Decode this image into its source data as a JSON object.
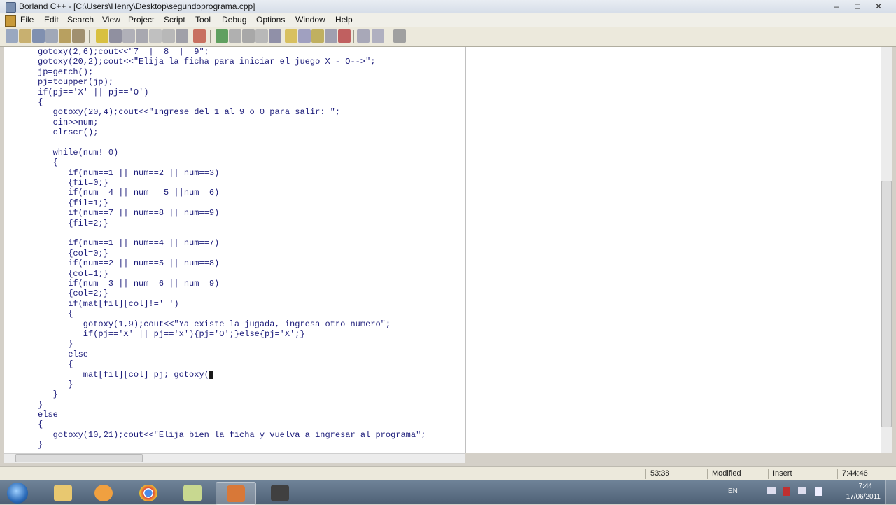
{
  "window": {
    "title": "Borland C++ - [C:\\Users\\Henry\\Desktop\\segundoprograma.cpp]",
    "controls": {
      "minimize": "–",
      "maximize": "□",
      "close": "✕"
    }
  },
  "menu": {
    "items": [
      "File",
      "Edit",
      "Search",
      "View",
      "Project",
      "Script",
      "Tool",
      "Debug",
      "Options",
      "Window",
      "Help"
    ]
  },
  "editor": {
    "file": "segundoprograma.cpp",
    "code_lines": [
      "gotoxy(2,6);cout<<\"7  |  8  |  9\";",
      "gotoxy(20,2);cout<<\"Elija la ficha para iniciar el juego X - O-->\";",
      "jp=getch();",
      "pj=toupper(jp);",
      "if(pj=='X' || pj=='O')",
      "{",
      "   gotoxy(20,4);cout<<\"Ingrese del 1 al 9 o 0 para salir: \";",
      "   cin>>num;",
      "   clrscr();",
      "",
      "   while(num!=0)",
      "   {",
      "      if(num==1 || num==2 || num==3)",
      "      {fil=0;}",
      "      if(num==4 || num== 5 ||num==6)",
      "      {fil=1;}",
      "      if(num==7 || num==8 || num==9)",
      "      {fil=2;}",
      "",
      "      if(num==1 || num==4 || num==7)",
      "      {col=0;}",
      "      if(num==2 || num==5 || num==8)",
      "      {col=1;}",
      "      if(num==3 || num==6 || num==9)",
      "      {col=2;}",
      "      if(mat[fil][col]!=' ')",
      "      {",
      "         gotoxy(1,9);cout<<\"Ya existe la jugada, ingresa otro numero\";",
      "         if(pj=='X' || pj=='x'){pj='O';}else{pj='X';}",
      "      }",
      "      else",
      "      {",
      "         mat[fil][col]=pj; gotoxy(",
      "      }",
      "   }",
      "}",
      "else",
      "{",
      "   gotoxy(10,21);cout<<\"Elija bien la ficha y vuelva a ingresar al programa\";",
      "}"
    ]
  },
  "status": {
    "position": "53:38",
    "modified": "Modified",
    "mode": "Insert",
    "time": "7:44:46"
  },
  "taskbar": {
    "apps": [
      "explorer-icon",
      "media-player-icon",
      "chrome-icon",
      "notepad-icon",
      "borland-icon",
      "recorder-icon"
    ],
    "language": "EN",
    "clock_time": "7:44",
    "clock_date": "17/06/2011"
  }
}
